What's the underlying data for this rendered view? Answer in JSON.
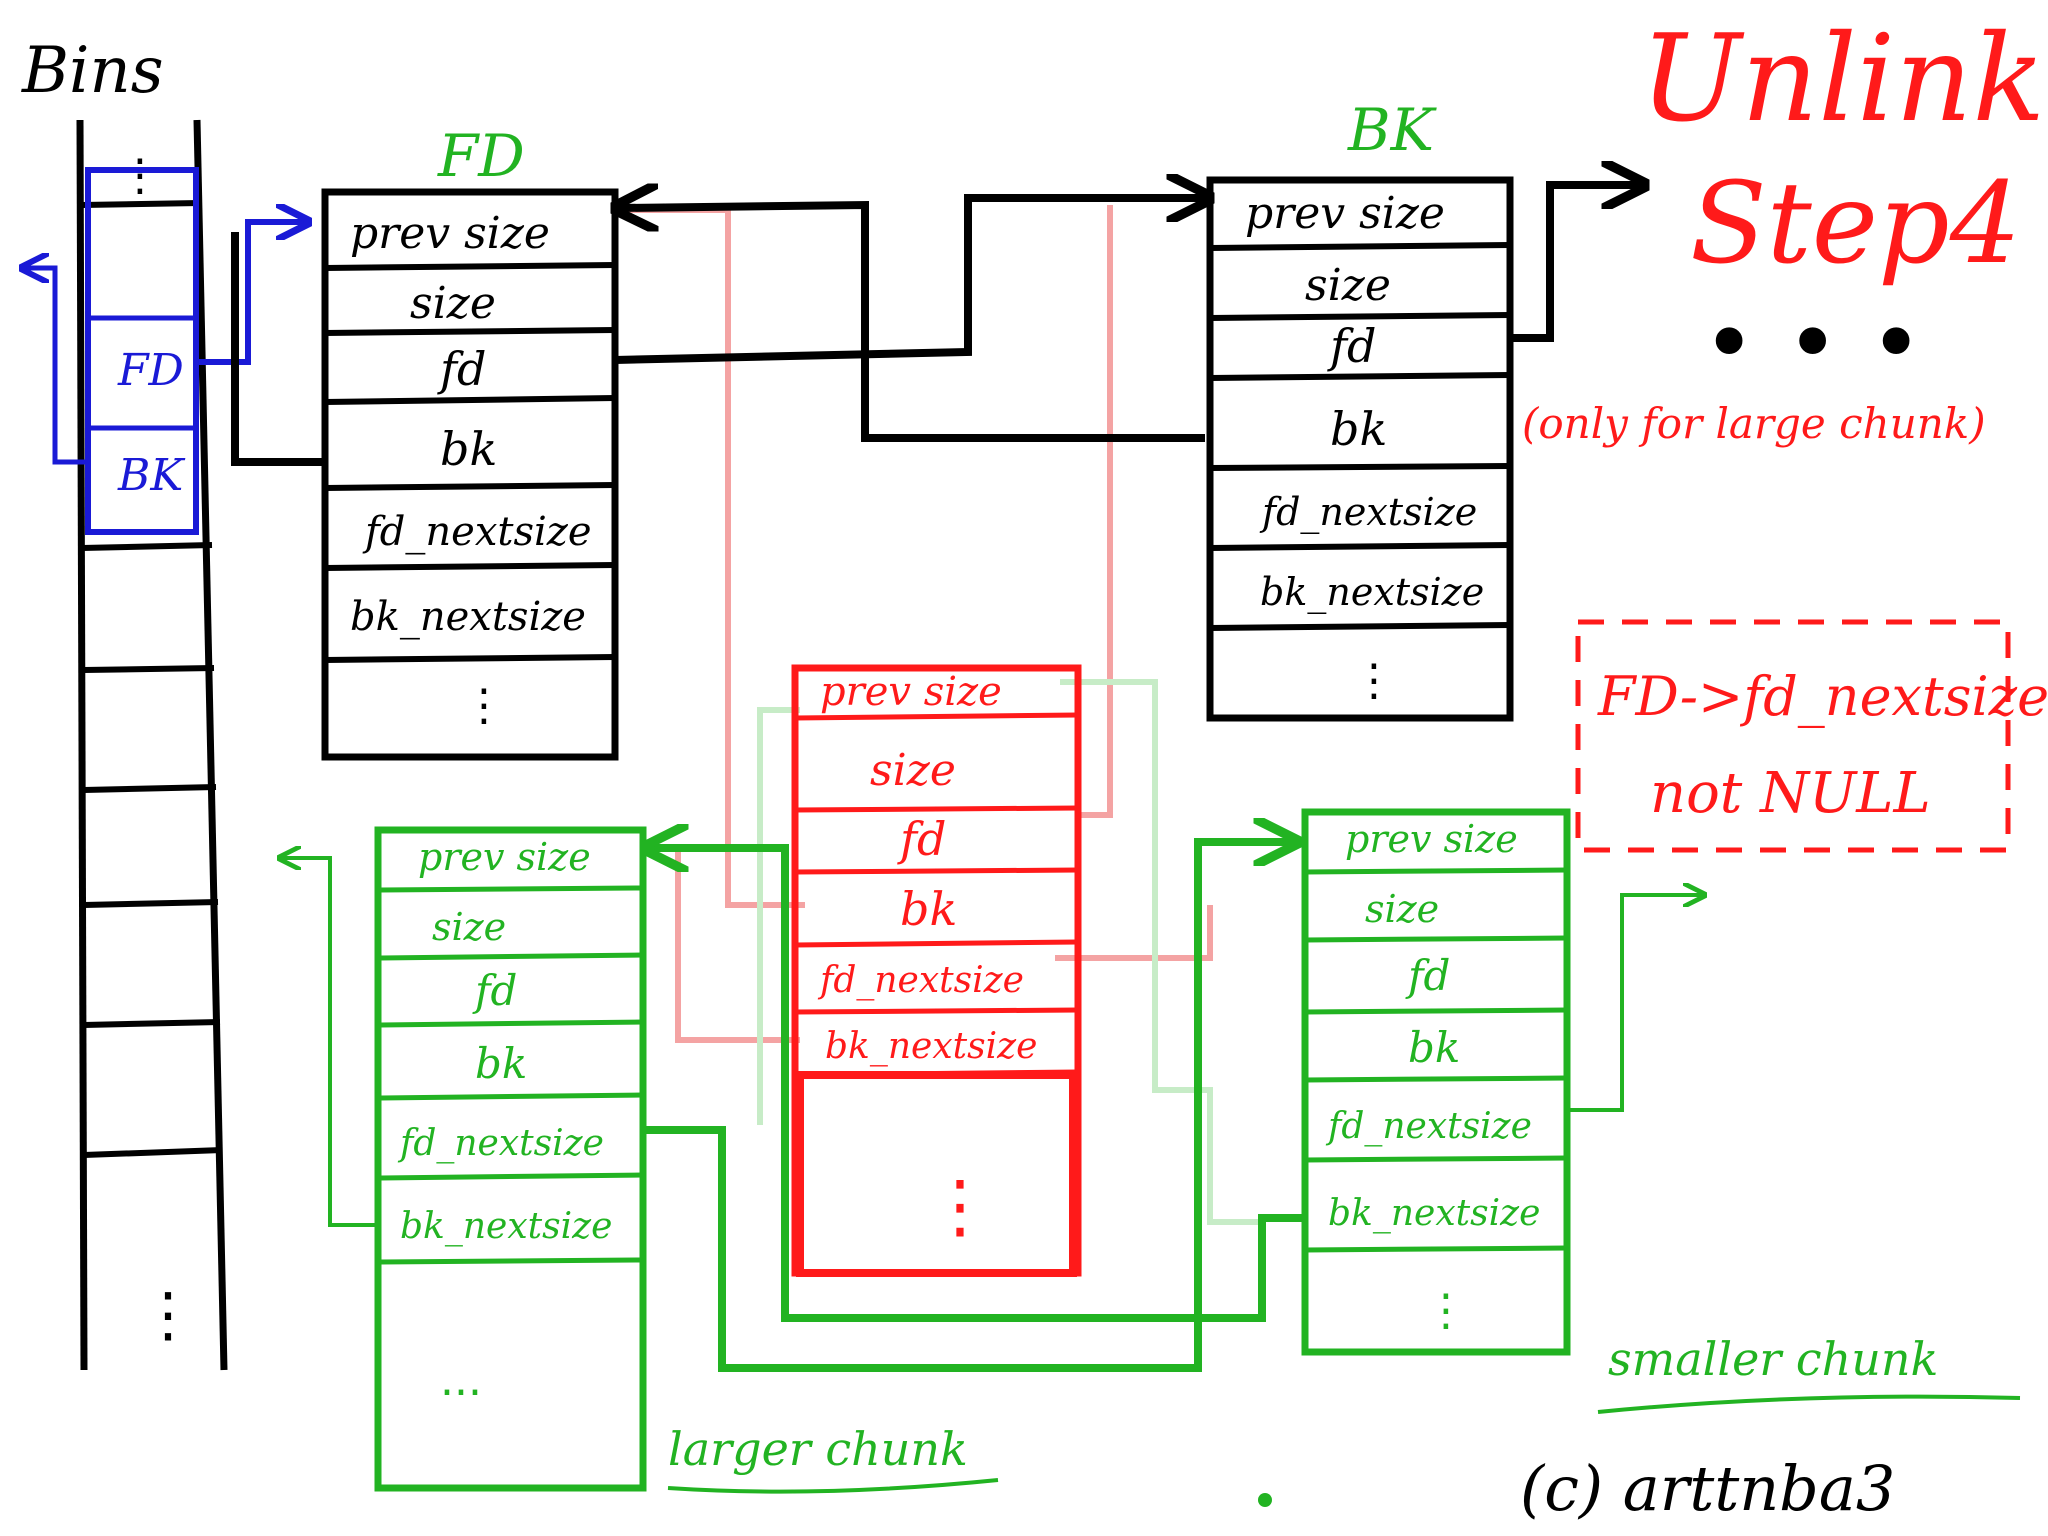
{
  "bins": {
    "title": "Bins",
    "fd_label": "FD",
    "bk_label": "BK"
  },
  "title": {
    "line1": "Unlink.",
    "line2": "Step4"
  },
  "chunks": {
    "fd": {
      "header": "FD",
      "fields": [
        "prev size",
        "size",
        "fd",
        "bk",
        "fd_nextsize",
        "bk_nextsize"
      ],
      "tail": "⋮"
    },
    "bk": {
      "header": "BK",
      "fields": [
        "prev size",
        "size",
        "fd",
        "bk",
        "fd_nextsize",
        "bk_nextsize"
      ],
      "tail": "⋮"
    },
    "victim": {
      "fields": [
        "prev size",
        "size",
        "fd",
        "bk",
        "fd_nextsize",
        "bk_nextsize"
      ],
      "tail": "⋮"
    },
    "larger": {
      "fields": [
        "prev size",
        "size",
        "fd",
        "bk",
        "fd_nextsize",
        "bk_nextsize"
      ],
      "tail": "...",
      "label": "larger chunk"
    },
    "smaller": {
      "fields": [
        "prev size",
        "size",
        "fd",
        "bk",
        "fd_nextsize",
        "bk_nextsize"
      ],
      "tail": "⋮",
      "label": "smaller chunk"
    }
  },
  "notes": {
    "large_only": "(only for large chunk)",
    "condition_line1": "FD->fd_nextsize",
    "condition_line2": "not NULL",
    "ellipsis": "• • •",
    "copyright": "(c) arttnba3"
  },
  "colors": {
    "black": "#000000",
    "blue": "#1a1ad6",
    "green": "#22b322",
    "red": "#ff1a1a",
    "pink": "#f4a3a3",
    "light_green": "#c7ecc7"
  }
}
